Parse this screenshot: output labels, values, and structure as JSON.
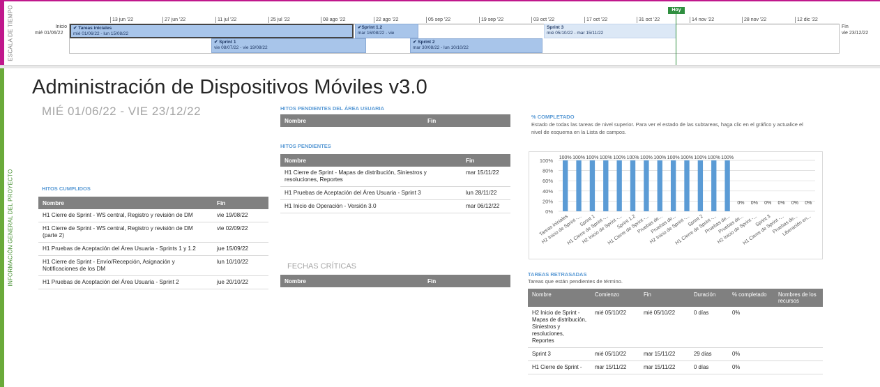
{
  "timeline": {
    "side_label": "ESCALA DE TIEMPO",
    "start_label": "Inicio",
    "start_date": "mié 01/06/22",
    "end_label": "Fin",
    "end_date": "vie 23/12/22",
    "today_label": "Hoy",
    "ticks": [
      "13 jun '22",
      "27 jun '22",
      "11 jul '22",
      "25 jul '22",
      "08 ago '22",
      "22 ago '22",
      "05 sep '22",
      "19 sep '22",
      "03 oct '22",
      "17 oct '22",
      "31 oct '22",
      "14 nov '22",
      "28 nov '22",
      "12 dic '22"
    ],
    "bars": [
      {
        "name": "Tareas iniciales",
        "dates": "mié 01/06/22 - lun 15/08/22",
        "done": true
      },
      {
        "name": "Sprint 1.2",
        "dates": "mar 16/08/22 - vie",
        "done": true
      },
      {
        "name": "Sprint 3",
        "dates": "mié 05/10/22 - mar 15/11/22",
        "done": false
      },
      {
        "name": "Sprint 1",
        "dates": "vie 08/07/22 - vie 19/08/22",
        "done": true
      },
      {
        "name": "Sprint 2",
        "dates": "mar 30/08/22 - lun 10/10/22",
        "done": true
      }
    ]
  },
  "info_label": "INFORMACIÓN GENERAL DEL PROYECTO",
  "title": "Administración de Dispositivos Móviles v3.0",
  "date_range": "MIÉ 01/06/22  -  VIE 23/12/22",
  "hitos_cumplidos": {
    "title": "HITOS CUMPLIDOS",
    "headers": [
      "Nombre",
      "Fin"
    ],
    "rows": [
      [
        "H1 Cierre de Sprint - WS central, Registro y revisión de DM",
        "vie 19/08/22"
      ],
      [
        "H1 Cierre de Sprint - WS central, Registro y revisión de DM (parte 2)",
        "vie 02/09/22"
      ],
      [
        "H1 Pruebas de Aceptación del Área Usuaria - Sprints 1 y 1.2",
        "jue 15/09/22"
      ],
      [
        "H1 Cierre de Sprint - Envío/Recepción, Asignación y Notificaciones de los DM",
        "lun 10/10/22"
      ],
      [
        "H1 Pruebas de Aceptación del Área Usuaria - Sprint 2",
        "jue 20/10/22"
      ]
    ]
  },
  "hitos_usuaria": {
    "title": "HITOS PENDIENTES DEL ÁREA USUARIA",
    "headers": [
      "Nombre",
      "Fin"
    ]
  },
  "hitos_pendientes": {
    "title": "HITOS PENDIENTES",
    "headers": [
      "Nombre",
      "Fin"
    ],
    "rows": [
      [
        "H1 Cierre de Sprint - Mapas de distribución, Siniestros y resoluciones, Reportes",
        "mar 15/11/22"
      ],
      [
        "H1 Pruebas de Aceptación del Área Usuaria - Sprint 3",
        "lun 28/11/22"
      ],
      [
        "H1 Inicio de Operación - Versión 3.0",
        "mar 06/12/22"
      ]
    ]
  },
  "fechas_criticas": {
    "title": "FECHAS CRÍTICAS",
    "headers": [
      "Nombre",
      "Fin"
    ]
  },
  "completado": {
    "title": "% COMPLETADO",
    "description": "Estado de todas las tareas de nivel superior. Para ver el estado de las subtareas, haga clic en el gráfico y actualice el nivel de esquema en la Lista de campos."
  },
  "chart_data": {
    "type": "bar",
    "categories": [
      "Tareas iniciales",
      "H2 Inicio de Sprint -...",
      "Sprint 1",
      "H1 Cierre de Sprint -...",
      "H2 Inicio de Sprint -...",
      "Sprint 1.2",
      "H1 Cierre de Sprint -...",
      "Pruebas de...",
      "Pruebas de...",
      "H2 Inicio de Sprint -...",
      "Sprint 2",
      "H1 Cierre de Sprint -...",
      "Pruebas de...",
      "Pruebas de...",
      "H2 Inicio de Sprint -...",
      "Sprint 3",
      "H1 Cierre de Sprint -...",
      "Pruebas de...",
      "Liberación en..."
    ],
    "values": [
      100,
      100,
      100,
      100,
      100,
      100,
      100,
      100,
      100,
      100,
      100,
      100,
      100,
      0,
      0,
      0,
      0,
      0,
      0
    ],
    "value_labels": [
      "100%",
      "100%",
      "100%",
      "100%",
      "100%",
      "100%",
      "100%",
      "100%",
      "100%",
      "100%",
      "100%",
      "100%",
      "100%",
      "0%",
      "0%",
      "0%",
      "0%",
      "0%",
      "0%"
    ],
    "yticks": [
      "0%",
      "20%",
      "40%",
      "60%",
      "80%",
      "100%"
    ],
    "ylim": [
      0,
      100
    ],
    "color": "#5b9bd5",
    "grid": true
  },
  "tareas_retrasadas": {
    "title": "TAREAS RETRASADAS",
    "description": "Tareas que están pendientes de término.",
    "headers": [
      "Nombre",
      "Comienzo",
      "Fin",
      "Duración",
      "% completado",
      "Nombres de los recursos"
    ],
    "rows": [
      [
        "H2 Inicio de Sprint - Mapas de distribución, Siniestros y resoluciones, Reportes",
        "mié 05/10/22",
        "mié 05/10/22",
        "0 días",
        "0%",
        ""
      ],
      [
        "Sprint 3",
        "mié 05/10/22",
        "mar 15/11/22",
        "29 días",
        "0%",
        ""
      ],
      [
        "H1 Cierre de Sprint -",
        "mar 15/11/22",
        "mar 15/11/22",
        "0 días",
        "0%",
        ""
      ]
    ]
  }
}
